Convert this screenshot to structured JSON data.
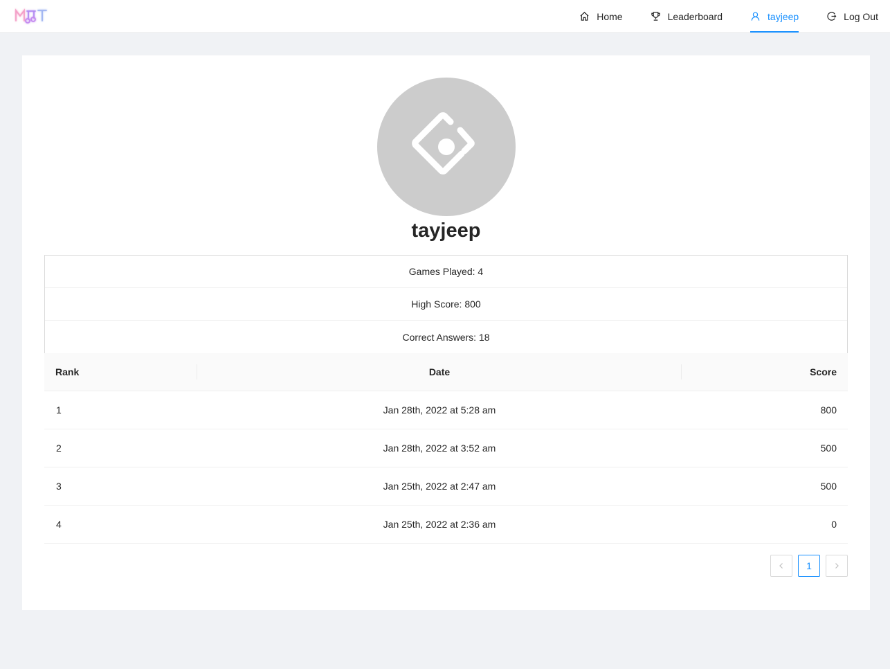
{
  "header": {
    "logo_text": "MQT",
    "nav": [
      {
        "label": "Home",
        "icon": "home-icon"
      },
      {
        "label": "Leaderboard",
        "icon": "trophy-icon"
      },
      {
        "label": "tayjeep",
        "icon": "user-icon",
        "active": true
      },
      {
        "label": "Log Out",
        "icon": "logout-icon"
      }
    ]
  },
  "profile": {
    "username": "tayjeep",
    "avatar_icon": "ant-design-logo-icon",
    "stats": [
      "Games Played: 4",
      "High Score: 800",
      "Correct Answers: 18"
    ]
  },
  "table": {
    "columns": [
      "Rank",
      "Date",
      "Score"
    ],
    "rows": [
      [
        "1",
        "Jan 28th, 2022 at 5:28 am",
        "800"
      ],
      [
        "2",
        "Jan 28th, 2022 at 3:52 am",
        "500"
      ],
      [
        "3",
        "Jan 25th, 2022 at 2:47 am",
        "500"
      ],
      [
        "4",
        "Jan 25th, 2022 at 2:36 am",
        "0"
      ]
    ]
  },
  "pagination": {
    "prev": "<",
    "current": "1",
    "next": ">"
  },
  "colors": {
    "accent": "#1890ff",
    "background": "#f0f2f5",
    "avatar_bg": "#cccccc"
  }
}
